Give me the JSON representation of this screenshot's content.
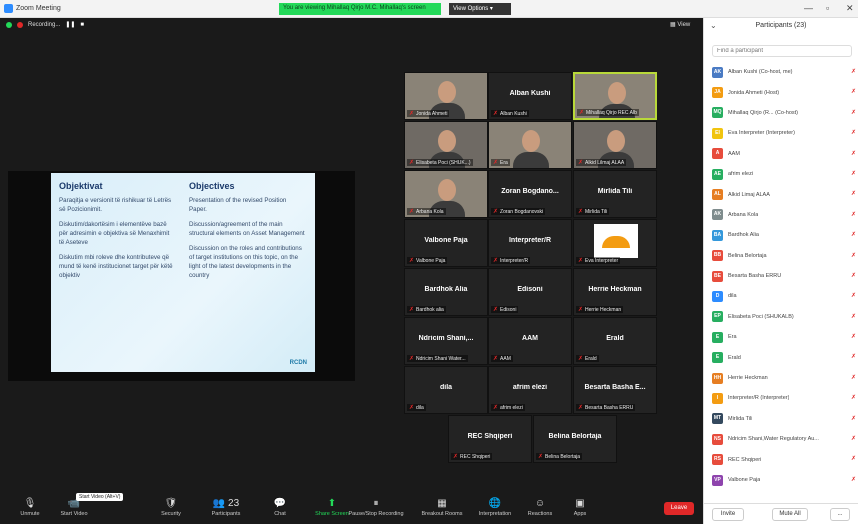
{
  "window": {
    "title": "Zoom Meeting",
    "minimize": "—",
    "maximize": "▫",
    "close": "✕"
  },
  "share_banner": "You are viewing Mihallaq Qirjo M.C. Mihallaq's screen",
  "view_options": "View Options ▾",
  "recording": {
    "label": "Recording...",
    "pause": "❚❚",
    "stop": "■"
  },
  "view_label": "▦ View",
  "slide": {
    "left_title": "Objektivat",
    "left_points": [
      "Paraqitja e versionit të rishikuar të Letrës së Pozicionimit.",
      "Diskutim/dakortësim i elementëve bazë për adresimin e objektiva së Menaxhimit të Aseteve",
      "Diskutim mbi roleve dhe kontributeve që mund të kenë institucionet target për këtë objektiv"
    ],
    "right_title": "Objectives",
    "right_points": [
      "Presentation of the revised Position Paper.",
      "Discussion/agreement of the main structural elements on Asset Management",
      "Discussion on the roles and contributions of target institutions on this topic, on the light of the latest developments in the country"
    ],
    "logo_text": "RCDN"
  },
  "tiles": [
    {
      "name": "",
      "label": "Jonida Ahmeti",
      "video": true
    },
    {
      "name": "Alban Kushi",
      "label": "Alban Kushi",
      "video": false
    },
    {
      "name": "",
      "label": "Mihallaq Qirjo REC Alb",
      "video": true,
      "active": true
    },
    {
      "name": "",
      "label": "Elisabeta Poci (SHUK...)",
      "video": true
    },
    {
      "name": "",
      "label": "Era",
      "video": true
    },
    {
      "name": "",
      "label": "Alkid Lilmaj ALAA",
      "video": true
    },
    {
      "name": "",
      "label": "Arbana Kola",
      "video": true
    },
    {
      "name": "Zoran Bogdano...",
      "label": "Zoran Bogdanovski",
      "video": false
    },
    {
      "name": "Mirlida Tili",
      "label": "Mirlida Tili",
      "video": false
    },
    {
      "name": "Valbone Paja",
      "label": "Valbone Paja",
      "video": false
    },
    {
      "name": "Interpreter/R",
      "label": "Interpreter/R",
      "video": false
    },
    {
      "name": "",
      "label": "Eva Interpreter",
      "video": "logo"
    },
    {
      "name": "Bardhok Alia",
      "label": "Bardhok alia",
      "video": false
    },
    {
      "name": "Edisoni",
      "label": "Edisoni",
      "video": false
    },
    {
      "name": "Herrie Heckman",
      "label": "Herrie Heckman",
      "video": false
    },
    {
      "name": "Ndricim Shani,...",
      "label": "Ndricim Shani Water...",
      "video": false
    },
    {
      "name": "AAM",
      "label": "AAM",
      "video": false
    },
    {
      "name": "Erald",
      "label": "Erald",
      "video": false
    },
    {
      "name": "dila",
      "label": "dila",
      "video": false
    },
    {
      "name": "afrim elezi",
      "label": "afrim elezi",
      "video": false
    },
    {
      "name": "Besarta Basha E...",
      "label": "Besarta Basha ERRU",
      "video": false
    },
    {
      "name": "REC Shqiperi",
      "label": "REC Shqiperi",
      "video": false
    },
    {
      "name": "Belina Belortaja",
      "label": "Belina Belortaja",
      "video": false
    }
  ],
  "toolbar": {
    "tooltip": "Start Video (Alt+V)",
    "buttons": [
      {
        "label": "Unmute",
        "icon": "🎙"
      },
      {
        "label": "Start Video",
        "icon": "📹"
      },
      {
        "label": "Security",
        "icon": "🛡"
      },
      {
        "label": "Participants",
        "icon": "👥",
        "count": "23"
      },
      {
        "label": "Chat",
        "icon": "💬"
      },
      {
        "label": "Share Screen",
        "icon": "⬆"
      },
      {
        "label": "Pause/Stop Recording",
        "icon": "⏸"
      },
      {
        "label": "Breakout Rooms",
        "icon": "▦"
      },
      {
        "label": "Interpretation",
        "icon": "🌐"
      },
      {
        "label": "Reactions",
        "icon": "☺"
      },
      {
        "label": "Apps",
        "icon": "▣"
      }
    ],
    "leave": "Leave"
  },
  "participants": {
    "title": "Participants (23)",
    "search_placeholder": "Find a participant",
    "list": [
      {
        "initials": "AK",
        "name": "Alban Kushi (Co-host, me)",
        "color": "#4a7bc4"
      },
      {
        "initials": "JA",
        "name": "Jonida Ahmeti (Host)",
        "color": "#f39c12"
      },
      {
        "initials": "MQ",
        "name": "Mihallaq Qirjo (R... (Co-host)",
        "color": "#27ae60"
      },
      {
        "initials": "EI",
        "name": "Eva Interpreter (Interpreter)",
        "color": "#f1c40f"
      },
      {
        "initials": "A",
        "name": "AAM",
        "color": "#e74c3c"
      },
      {
        "initials": "AE",
        "name": "afrim elezi",
        "color": "#27ae60"
      },
      {
        "initials": "AL",
        "name": "Alkid Limaj ALAA",
        "color": "#e67e22"
      },
      {
        "initials": "AK",
        "name": "Arbana Kola",
        "color": "#7f8c8d"
      },
      {
        "initials": "BA",
        "name": "Bardhok Alia",
        "color": "#3498db"
      },
      {
        "initials": "BB",
        "name": "Belina Belortaja",
        "color": "#e74c3c"
      },
      {
        "initials": "BE",
        "name": "Besarta Basha ERRU",
        "color": "#e74c3c"
      },
      {
        "initials": "D",
        "name": "dila",
        "color": "#2d8cff"
      },
      {
        "initials": "EP",
        "name": "Elisabeta Poci (SHUKALB)",
        "color": "#27ae60"
      },
      {
        "initials": "E",
        "name": "Era",
        "color": "#27ae60"
      },
      {
        "initials": "E",
        "name": "Erald",
        "color": "#27ae60"
      },
      {
        "initials": "HH",
        "name": "Herrie Heckman",
        "color": "#e67e22"
      },
      {
        "initials": "I",
        "name": "Interpreter/R (Interpreter)",
        "color": "#f39c12"
      },
      {
        "initials": "MT",
        "name": "Mirlida Tili",
        "color": "#34495e"
      },
      {
        "initials": "NS",
        "name": "Ndricim Shani,Water Regulatory Au...",
        "color": "#e74c3c"
      },
      {
        "initials": "RS",
        "name": "REC Shqiperi",
        "color": "#e74c3c"
      },
      {
        "initials": "VP",
        "name": "Valbone Paja",
        "color": "#8e44ad"
      }
    ],
    "invite": "Invite",
    "mute_all": "Mute All",
    "more": "..."
  }
}
